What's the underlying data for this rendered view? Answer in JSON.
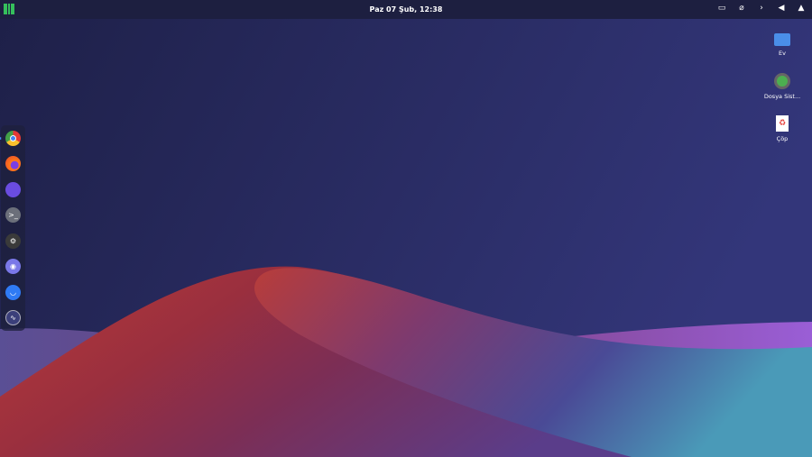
{
  "topbar": {
    "clock": "Paz 07 Şub, 12:38",
    "tray_icons": [
      "screen-icon",
      "paperclip-icon",
      "chevron-right-icon",
      "volume-icon",
      "bell-icon"
    ]
  },
  "dock": {
    "apps": [
      "Chrome",
      "Firefox",
      "App",
      "Terminal",
      "Steam",
      "Discord",
      "Store",
      "System Monitor"
    ]
  },
  "desktop": {
    "icons": [
      {
        "label": "Ev"
      },
      {
        "label": "Dosya Sist..."
      },
      {
        "label": "Çöp"
      }
    ]
  },
  "colors": {
    "accent": "#35bf5c",
    "bar": "#1d1f40"
  }
}
